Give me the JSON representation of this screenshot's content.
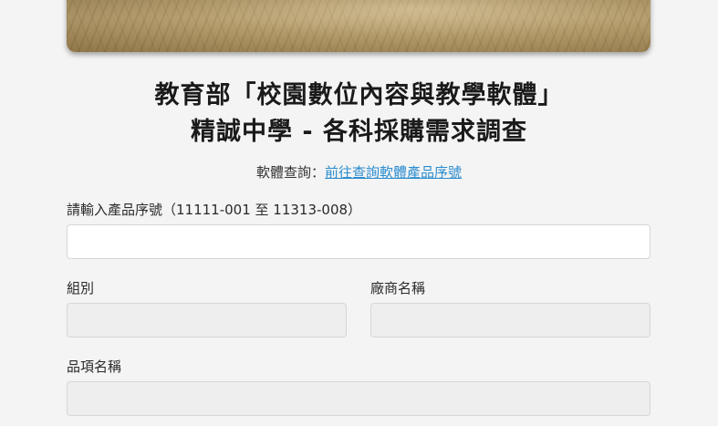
{
  "header": {
    "title_line1": "教育部「校園數位內容與教學軟體」",
    "title_line2": "精誠中學 - 各科採購需求調查"
  },
  "lookup": {
    "prefix": "軟體查詢：",
    "link_text": "前往查詢軟體產品序號"
  },
  "form": {
    "serial_label": "請輸入產品序號（11111-001 至 11313-008）",
    "serial_value": "",
    "group_label": "組別",
    "group_value": "",
    "vendor_label": "廠商名稱",
    "vendor_value": "",
    "item_label": "品項名稱",
    "item_value": ""
  }
}
